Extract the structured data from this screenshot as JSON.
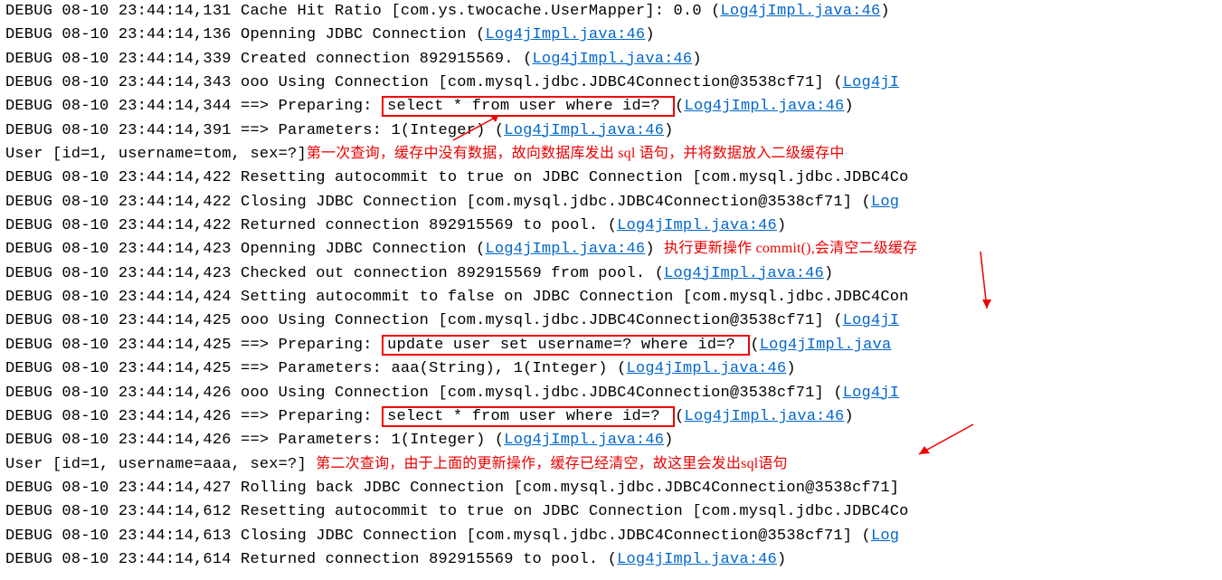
{
  "log": {
    "link_common": "Log4jImpl.java:46",
    "link_trunc1": "Log4jI",
    "link_trunc2": "Log",
    "link_trunc3": "Log4jImpl.java",
    "lines": {
      "l0_a": "DEBUG 08-10 23:44:14,131 Cache Hit Ratio [com.ys.twocache.UserMapper]: 0.0  (",
      "l0_b": ")",
      "l1_a": "DEBUG 08-10 23:44:14,136 Openning JDBC Connection  (",
      "l1_b": ")",
      "l2_a": "DEBUG 08-10 23:44:14,339 Created connection 892915569.  (",
      "l2_b": ")",
      "l3_a": "DEBUG 08-10 23:44:14,343 ooo Using Connection [com.mysql.jdbc.JDBC4Connection@3538cf71]  (",
      "l4_a": "DEBUG 08-10 23:44:14,344 ==>  Preparing: ",
      "l4_box": "select * from user where id=? ",
      "l4_b": "  (",
      "l4_c": ")",
      "l5_a": "DEBUG 08-10 23:44:14,391 ==> Parameters: 1(Integer)   (",
      "l5_b": ")",
      "l6_a": "User [id=1, username=tom, sex=?]",
      "l7_a": "DEBUG 08-10 23:44:14,422 Resetting autocommit to true on JDBC Connection [com.mysql.jdbc.JDBC4Co",
      "l8_a": "DEBUG 08-10 23:44:14,422 Closing JDBC Connection [com.mysql.jdbc.JDBC4Connection@3538cf71]  (",
      "l9_a": "DEBUG 08-10 23:44:14,422 Returned connection 892915569 to pool.  (",
      "l9_b": ")",
      "l10_a": "DEBUG 08-10 23:44:14,423 Openning JDBC Connection  (",
      "l10_b": ") ",
      "l11_a": "DEBUG 08-10 23:44:14,423 Checked out connection 892915569 from pool.  (",
      "l11_b": ")",
      "l12_a": "DEBUG 08-10 23:44:14,424 Setting autocommit to false on JDBC Connection [com.mysql.jdbc.JDBC4Con",
      "l13_a": "DEBUG 08-10 23:44:14,425 ooo Using Connection [com.mysql.jdbc.JDBC4Connection@3538cf71]  (",
      "l14_a": "DEBUG 08-10 23:44:14,425 ==>  Preparing: ",
      "l14_box": "update user set username=? where id=? ",
      "l14_b": "  (",
      "l15_a": "DEBUG 08-10 23:44:14,425 ==> Parameters: aaa(String), 1(Integer)   (",
      "l15_b": ")",
      "l16_a": "DEBUG 08-10 23:44:14,426 ooo Using Connection [com.mysql.jdbc.JDBC4Connection@3538cf71]  (",
      "l17_a": "DEBUG 08-10 23:44:14,426 ==>  Preparing: ",
      "l17_box": "select * from user where id=? ",
      "l17_b": "  (",
      "l17_c": ")",
      "l18_a": "DEBUG 08-10 23:44:14,426 ==> Parameters: 1(Integer)   (",
      "l18_b": ")",
      "l19_a": "User [id=1, username=aaa, sex=?]  ",
      "l20_a": "DEBUG 08-10 23:44:14,427 Rolling back JDBC Connection [com.mysql.jdbc.JDBC4Connection@3538cf71]",
      "l21_a": "DEBUG 08-10 23:44:14,612 Resetting autocommit to true on JDBC Connection [com.mysql.jdbc.JDBC4Co",
      "l22_a": "DEBUG 08-10 23:44:14,613 Closing JDBC Connection [com.mysql.jdbc.JDBC4Connection@3538cf71]  (",
      "l23_a": "DEBUG 08-10 23:44:14,614 Returned connection 892915569 to pool.  (",
      "l23_b": ")"
    }
  },
  "annotations": {
    "ann1": "第一次查询，缓存中没有数据，故向数据库发出 sql 语句，并将数据放入二级缓存中",
    "ann2": "执行更新操作 commit(),会清空二级缓存",
    "ann3": "第二次查询，由于上面的更新操作，缓存已经清空，故这里会发出sql语句"
  }
}
